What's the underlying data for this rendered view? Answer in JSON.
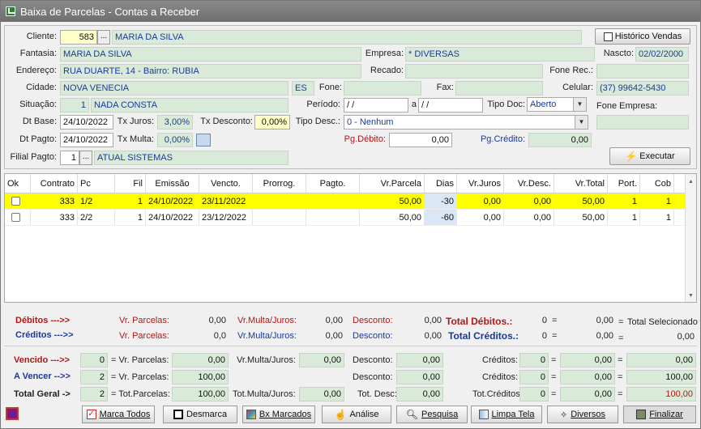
{
  "window": {
    "title": "Baixa de Parcelas - Contas a Receber"
  },
  "form": {
    "cliente_label": "Cliente:",
    "cliente_code": "583",
    "cliente_name": "MARIA DA SILVA",
    "historico_btn": "Histórico Vendas",
    "fantasia_label": "Fantasia:",
    "fantasia": "MARIA DA SILVA",
    "empresa_label": "Empresa:",
    "empresa": "* DIVERSAS",
    "nascto_label": "Nascto:",
    "nascto": "02/02/2000",
    "endereco_label": "Endereço:",
    "endereco": "RUA DUARTE, 14  - Bairro: RUBIA",
    "recado_label": "Recado:",
    "recado": "",
    "fonerec_label": "Fone Rec.:",
    "fonerec": "",
    "cidade_label": "Cidade:",
    "cidade": "NOVA VENECIA",
    "uf": "ES",
    "fone_label": "Fone:",
    "fone": "",
    "fax_label": "Fax:",
    "fax": "",
    "celular_label": "Celular:",
    "celular": "(37) 99642-5430",
    "situacao_label": "Situação:",
    "situacao_code": "1",
    "situacao": "NADA CONSTA",
    "periodo_label": "Período:",
    "periodo_de": " /  /",
    "periodo_a_label": "a",
    "periodo_ate": " /  /",
    "tipodoc_label": "Tipo Doc:",
    "tipodoc": "Aberto",
    "foneempresa_label": "Fone Empresa:",
    "foneempresa": "",
    "dtbase_label": "Dt Base:",
    "dtbase": "24/10/2022",
    "txjuros_label": "Tx Juros:",
    "txjuros": "3,00%",
    "txdesconto_label": "Tx Desconto:",
    "txdesconto": "0,00%",
    "tipodesc_label": "Tipo Desc.:",
    "tipodesc": "0 - Nenhum",
    "dtpagto_label": "Dt Pagto:",
    "dtpagto": "24/10/2022",
    "txmulta_label": "Tx Multa:",
    "txmulta": "0,00%",
    "pgdebito_label": "Pg.Débito:",
    "pgdebito": "0,00",
    "pgcredito_label": "Pg.Crédito:",
    "pgcredito": "0,00",
    "filial_label": "Filial Pagto:",
    "filial_code": "1",
    "filial": "ATUAL SISTEMAS",
    "executar_btn": "Executar",
    "lookup_btn": "..."
  },
  "grid": {
    "headers": [
      "Ok",
      "Contrato",
      "Pc",
      "Fil",
      "Emissão",
      "Vencto.",
      "Prorrog.",
      "Pagto.",
      "Vr.Parcela",
      "Dias",
      "Vr.Juros",
      "Vr.Desc.",
      "Vr.Total",
      "Port.",
      "Cob"
    ],
    "rows": [
      {
        "contrato": "333",
        "pc": "1/2",
        "fil": "1",
        "emissao": "24/10/2022",
        "vencto": "23/11/2022",
        "prorrog": "",
        "pagto": "",
        "vrparcela": "50,00",
        "dias": "-30",
        "vrjuros": "0,00",
        "vrdesc": "0,00",
        "vrtotal": "50,00",
        "port": "1",
        "cob": "1"
      },
      {
        "contrato": "333",
        "pc": "2/2",
        "fil": "1",
        "emissao": "24/10/2022",
        "vencto": "23/12/2022",
        "prorrog": "",
        "pagto": "",
        "vrparcela": "50,00",
        "dias": "-60",
        "vrjuros": "0,00",
        "vrdesc": "0,00",
        "vrtotal": "50,00",
        "port": "1",
        "cob": "1"
      }
    ]
  },
  "totals": {
    "debitos_label": "Débitos --->>",
    "creditos_label": "Créditos --->>",
    "vrparcelas_label": "Vr. Parcelas:",
    "vrmulta_label": "Vr.Multa/Juros:",
    "desconto_label": "Desconto:",
    "deb_vrparcelas": "0,00",
    "deb_vrmulta": "0,00",
    "deb_desconto": "0,00",
    "cre_vrparcelas": "0,0",
    "cre_vrmulta": "0,00",
    "cre_desconto": "0,00",
    "total_debitos_label": "Total Débitos.:",
    "total_debitos_qtd": "0",
    "total_debitos_val": "0,00",
    "total_creditos_label": "Total Créditos.:",
    "total_creditos_qtd": "0",
    "total_creditos_val": "0,00",
    "eq": "=",
    "total_selecionado_label": "Total Selecionado",
    "total_selecionado": "0,00"
  },
  "summary": {
    "vencido_label": "Vencido --->>",
    "avencer_label": "A Vencer -->>",
    "totalgeral_label": "Total Geral ->",
    "vencido_qtd": "0",
    "avencer_qtd": "2",
    "totalgeral_qtd": "2",
    "eq_vrparcelas": "= Vr. Parcelas:",
    "eq_totparcelas": "= Tot.Parcelas:",
    "vencido_vrparcelas": "0,00",
    "avencer_vrparcelas": "100,00",
    "totalgeral_totparcelas": "100,00",
    "vrmulta_label": "Vr.Multa/Juros:",
    "vencido_vrmulta": "0,00",
    "totmulta_label": "Tot.Multa/Juros:",
    "totalgeral_totmulta": "0,00",
    "desconto_label": "Desconto:",
    "totdesc_label": "Tot. Desc:",
    "vencido_desconto": "0,00",
    "avencer_desconto": "0,00",
    "totalgeral_totdesc": "0,00",
    "creditos_label": "Créditos:",
    "totcreditos_label": "Tot.Créditos:",
    "vencido_creditos_qtd": "0",
    "avencer_creditos_qtd": "0",
    "totalgeral_creditos_qtd": "0",
    "vencido_creditos_val": "0,00",
    "avencer_creditos_val": "0,00",
    "totalgeral_creditos_val": "0,00",
    "vencido_final": "0,00",
    "avencer_final": "100,00",
    "totalgeral_final": "100,00"
  },
  "buttons": {
    "marca_todos": "Marca Todos",
    "desmarca": "Desmarca",
    "bx_marcados": "Bx Marcados",
    "analise": "Análise",
    "pesquisa": "Pesquisa",
    "limpa_tela": "Limpa Tela",
    "diversos": "Diversos",
    "finalizar": "Finalizar"
  }
}
